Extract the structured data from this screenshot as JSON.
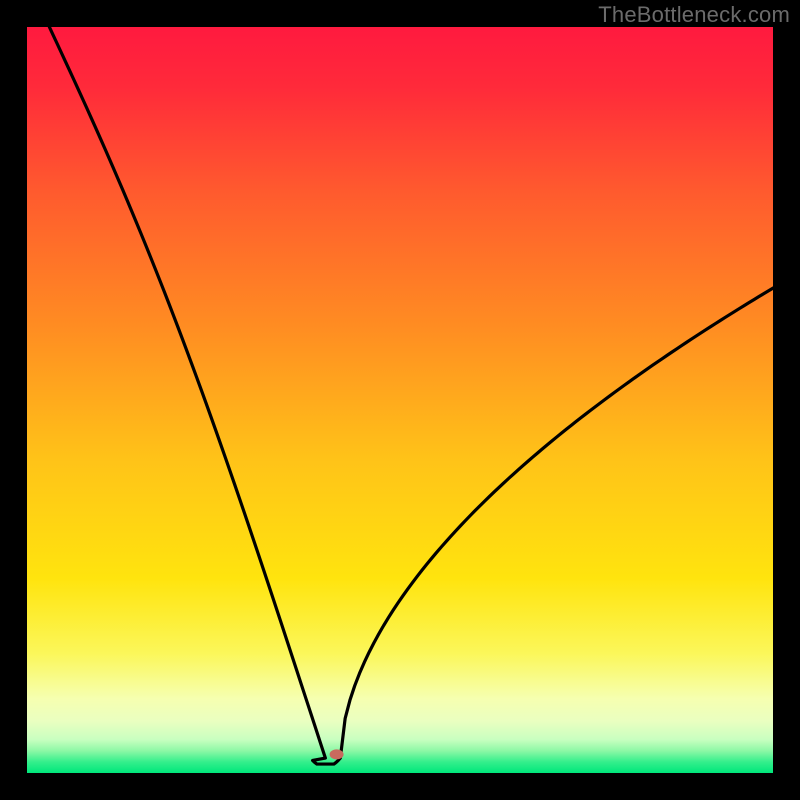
{
  "watermark": "TheBottleneck.com",
  "chart_data": {
    "type": "line",
    "title": "",
    "xlabel": "",
    "ylabel": "",
    "xlim": [
      0,
      100
    ],
    "ylim": [
      0,
      100
    ],
    "grid": false,
    "legend": false,
    "curve": {
      "description": "V-shaped bottleneck curve with minimum near x≈40, steep left arm and shallow right arm",
      "min_x": 40,
      "min_y": 2,
      "left_start": {
        "x": 3,
        "y": 100
      },
      "right_end": {
        "x": 100,
        "y": 65
      }
    },
    "gradient": {
      "top": "#ff173e",
      "mid1": "#ff7a29",
      "mid2": "#ffd e00",
      "bottom_band": "#f7ffb0",
      "green": "#00e77b"
    },
    "marker": {
      "x": 41.5,
      "y": 2.5,
      "color": "#c96a5e",
      "rx": 7,
      "ry": 5
    }
  }
}
